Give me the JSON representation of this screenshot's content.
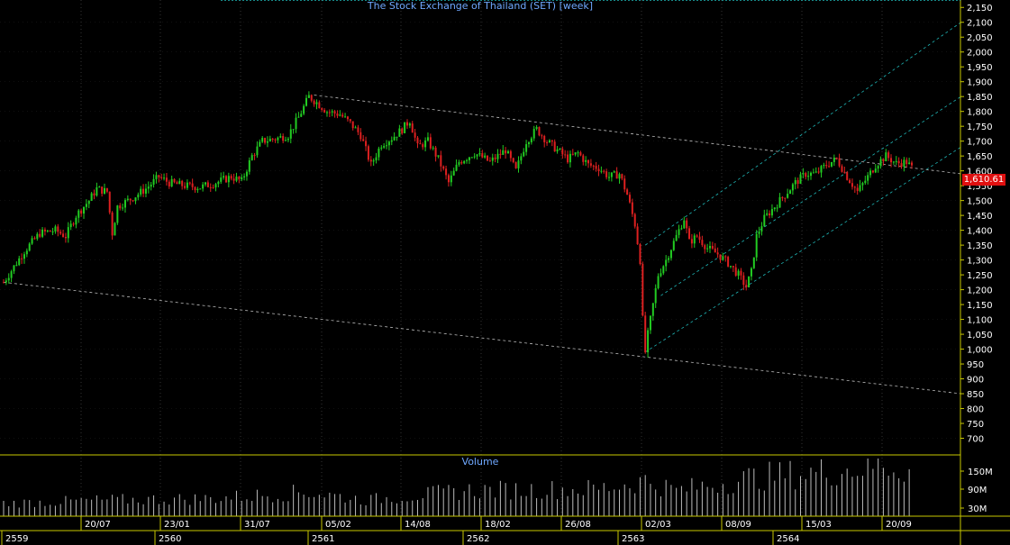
{
  "chart_data": {
    "type": "candlestick",
    "title": "The Stock Exchange of Thailand (SET) [week]",
    "volume_title": "Volume",
    "last_price": "1,610.61",
    "colors": {
      "up": "#22cc22",
      "down": "#dd2020",
      "volume": "#bbbbbb",
      "axis_text": "#ffffff",
      "grid": "#555555",
      "frame": "#c8c800",
      "title": "#6fa8ff",
      "trend": "#bbbbbb",
      "channel": "#1fb5b5"
    },
    "price_axis": {
      "ticks": [
        "2,150",
        "2,100",
        "2,050",
        "2,000",
        "1,950",
        "1,900",
        "1,850",
        "1,800",
        "1,750",
        "1,700",
        "1,650",
        "1,600",
        "1,550",
        "1,500",
        "1,450",
        "1,400",
        "1,350",
        "1,300",
        "1,250",
        "1,200",
        "1,150",
        "1,100",
        "1,050",
        "1,000",
        "950",
        "900",
        "850",
        "800",
        "750",
        "700"
      ],
      "ylim": [
        650,
        2175
      ]
    },
    "volume_axis": {
      "ticks": [
        "150M",
        "90M",
        "30M"
      ]
    },
    "date_labels": [
      "20/07",
      "23/01",
      "31/07",
      "05/02",
      "14/08",
      "18/02",
      "26/08",
      "02/03",
      "08/09",
      "15/03",
      "20/09"
    ],
    "year_labels": [
      "2559",
      "2560",
      "2561",
      "2562",
      "2563",
      "2564"
    ],
    "price_path": [
      [
        0,
        1225
      ],
      [
        8,
        1330
      ],
      [
        14,
        1390
      ],
      [
        20,
        1400
      ],
      [
        24,
        1380
      ],
      [
        28,
        1450
      ],
      [
        33,
        1500
      ],
      [
        36,
        1540
      ],
      [
        40,
        1530
      ],
      [
        42,
        1390
      ],
      [
        44,
        1480
      ],
      [
        50,
        1510
      ],
      [
        55,
        1540
      ],
      [
        60,
        1580
      ],
      [
        64,
        1560
      ],
      [
        70,
        1550
      ],
      [
        76,
        1545
      ],
      [
        82,
        1560
      ],
      [
        88,
        1580
      ],
      [
        92,
        1565
      ],
      [
        96,
        1650
      ],
      [
        100,
        1700
      ],
      [
        106,
        1710
      ],
      [
        110,
        1720
      ],
      [
        114,
        1780
      ],
      [
        118,
        1850
      ],
      [
        121,
        1830
      ],
      [
        125,
        1800
      ],
      [
        130,
        1790
      ],
      [
        134,
        1760
      ],
      [
        138,
        1720
      ],
      [
        142,
        1620
      ],
      [
        146,
        1690
      ],
      [
        150,
        1710
      ],
      [
        154,
        1740
      ],
      [
        157,
        1770
      ],
      [
        160,
        1680
      ],
      [
        164,
        1700
      ],
      [
        168,
        1640
      ],
      [
        172,
        1560
      ],
      [
        176,
        1630
      ],
      [
        182,
        1660
      ],
      [
        188,
        1630
      ],
      [
        194,
        1670
      ],
      [
        198,
        1600
      ],
      [
        202,
        1700
      ],
      [
        206,
        1740
      ],
      [
        210,
        1700
      ],
      [
        214,
        1670
      ],
      [
        218,
        1640
      ],
      [
        222,
        1660
      ],
      [
        226,
        1620
      ],
      [
        230,
        1610
      ],
      [
        234,
        1580
      ],
      [
        238,
        1590
      ],
      [
        241,
        1520
      ],
      [
        244,
        1420
      ],
      [
        246,
        1300
      ],
      [
        247,
        1100
      ],
      [
        248,
        990
      ],
      [
        249,
        1050
      ],
      [
        251,
        1150
      ],
      [
        253,
        1250
      ],
      [
        256,
        1300
      ],
      [
        260,
        1380
      ],
      [
        263,
        1440
      ],
      [
        265,
        1360
      ],
      [
        268,
        1380
      ],
      [
        272,
        1340
      ],
      [
        276,
        1320
      ],
      [
        280,
        1290
      ],
      [
        284,
        1250
      ],
      [
        287,
        1210
      ],
      [
        289,
        1260
      ],
      [
        291,
        1380
      ],
      [
        294,
        1440
      ],
      [
        298,
        1480
      ],
      [
        302,
        1520
      ],
      [
        306,
        1560
      ],
      [
        310,
        1590
      ],
      [
        314,
        1590
      ],
      [
        318,
        1620
      ],
      [
        322,
        1640
      ],
      [
        326,
        1580
      ],
      [
        330,
        1530
      ],
      [
        334,
        1580
      ],
      [
        337,
        1620
      ],
      [
        341,
        1650
      ],
      [
        345,
        1625
      ],
      [
        349,
        1630
      ],
      [
        351,
        1610
      ]
    ],
    "volume_path": [
      [
        0,
        40
      ],
      [
        40,
        50
      ],
      [
        80,
        55
      ],
      [
        118,
        75
      ],
      [
        140,
        50
      ],
      [
        180,
        80
      ],
      [
        230,
        85
      ],
      [
        248,
        110
      ],
      [
        260,
        80
      ],
      [
        290,
        120
      ],
      [
        320,
        140
      ],
      [
        340,
        160
      ],
      [
        351,
        145
      ]
    ],
    "candles_count": 352
  }
}
